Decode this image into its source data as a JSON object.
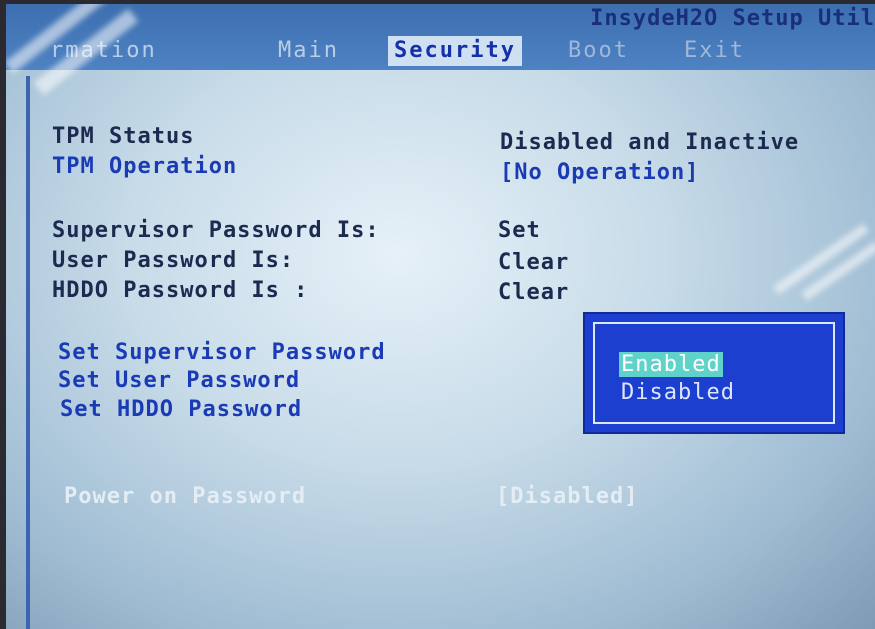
{
  "app_title": "InsydeH2O Setup Util",
  "tabs": [
    {
      "label": "rmation"
    },
    {
      "label": "Main"
    },
    {
      "label": "Security"
    },
    {
      "label": "Boot"
    },
    {
      "label": "Exit"
    }
  ],
  "active_tab": "Security",
  "settings": {
    "tpm_status": {
      "label": "TPM Status",
      "value": "Disabled and Inactive"
    },
    "tpm_operation": {
      "label": "TPM Operation",
      "value": "[No Operation]"
    },
    "supervisor_password": {
      "label": "Supervisor Password Is:",
      "value": "Set"
    },
    "user_password": {
      "label": "User Password Is:",
      "value": "Clear"
    },
    "hddo_password": {
      "label": "HDDO Password Is :",
      "value": "Clear"
    },
    "set_supervisor": {
      "label": "Set Supervisor Password"
    },
    "set_user": {
      "label": "Set User Password"
    },
    "set_hddo": {
      "label": "Set HDDO Password"
    },
    "power_on_password": {
      "label": "Power on Password",
      "value": "[Disabled]"
    }
  },
  "popup": {
    "options": [
      "Enabled",
      "Disabled"
    ],
    "selected": "Enabled"
  },
  "colors": {
    "header": "#4e82c2",
    "selectable_text": "#1a3bb5",
    "static_text": "#1c2a4f",
    "popup_bg": "#1c3fcf",
    "highlight": "#5fd3c9"
  }
}
